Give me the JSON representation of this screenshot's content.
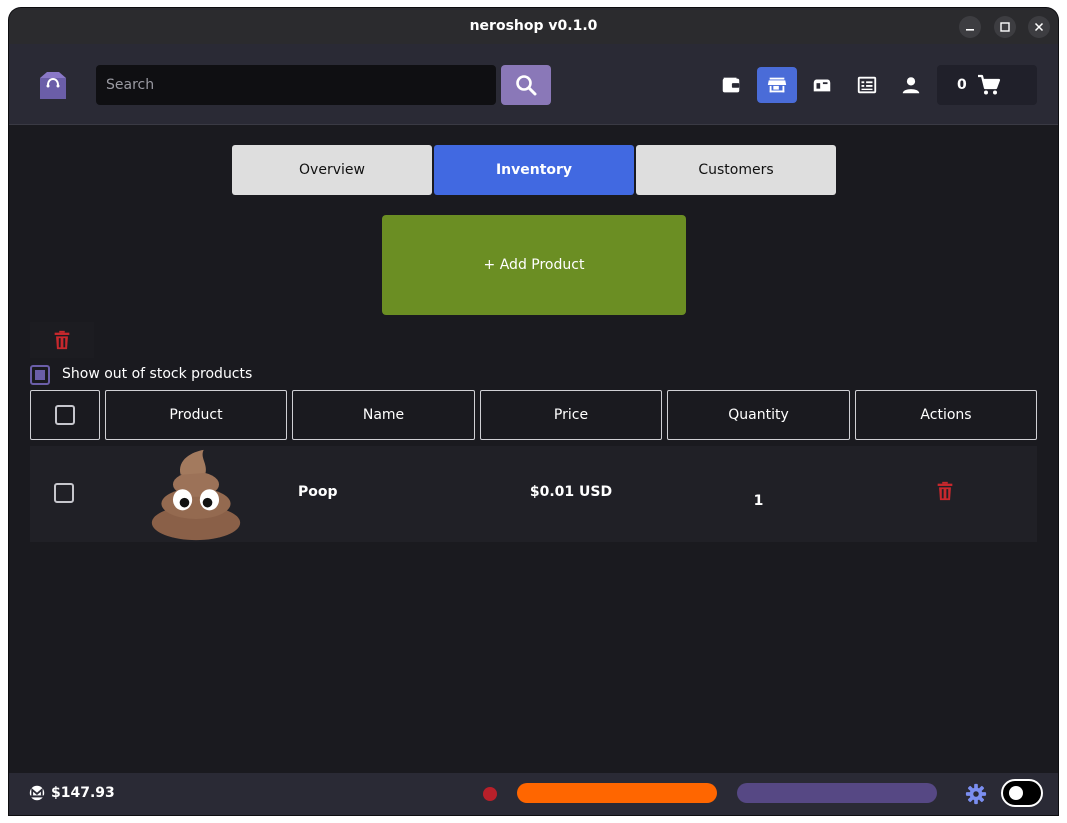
{
  "window": {
    "title": "neroshop v0.1.0",
    "controls": [
      "minimize-icon",
      "maximize-icon",
      "close-icon"
    ]
  },
  "header": {
    "search_placeholder": "Search",
    "nav_icons": [
      "wallet-icon",
      "store-icon",
      "mailbox-icon",
      "orders-icon",
      "user-icon"
    ],
    "active_nav": "store-icon",
    "cart_count": "0"
  },
  "tabs": [
    {
      "label": "Overview",
      "active": false
    },
    {
      "label": "Inventory",
      "active": true
    },
    {
      "label": "Customers",
      "active": false
    }
  ],
  "inventory": {
    "add_product_label": "+ Add Product",
    "show_out_of_stock_label": "Show out of stock products",
    "show_out_of_stock_checked": true,
    "columns": [
      "Product",
      "Name",
      "Price",
      "Quantity",
      "Actions"
    ],
    "rows": [
      {
        "image": "poop-emoji",
        "name": "Poop",
        "price": "$0.01 USD",
        "quantity": "1",
        "checked": false
      }
    ]
  },
  "status": {
    "balance": "$147.93",
    "currency_icon": "monero-icon",
    "connection_dot_color": "#b8202a",
    "sync_bar_color": "#ff6600",
    "sync_progress": 1.0,
    "secondary_bar_color": "#564884",
    "secondary_progress": 1.0,
    "theme_toggle": "dark"
  },
  "colors": {
    "accent": "#4169e1",
    "add_button": "#6b8e23",
    "delete": "#c8282d",
    "search_button": "#8a78b8"
  }
}
